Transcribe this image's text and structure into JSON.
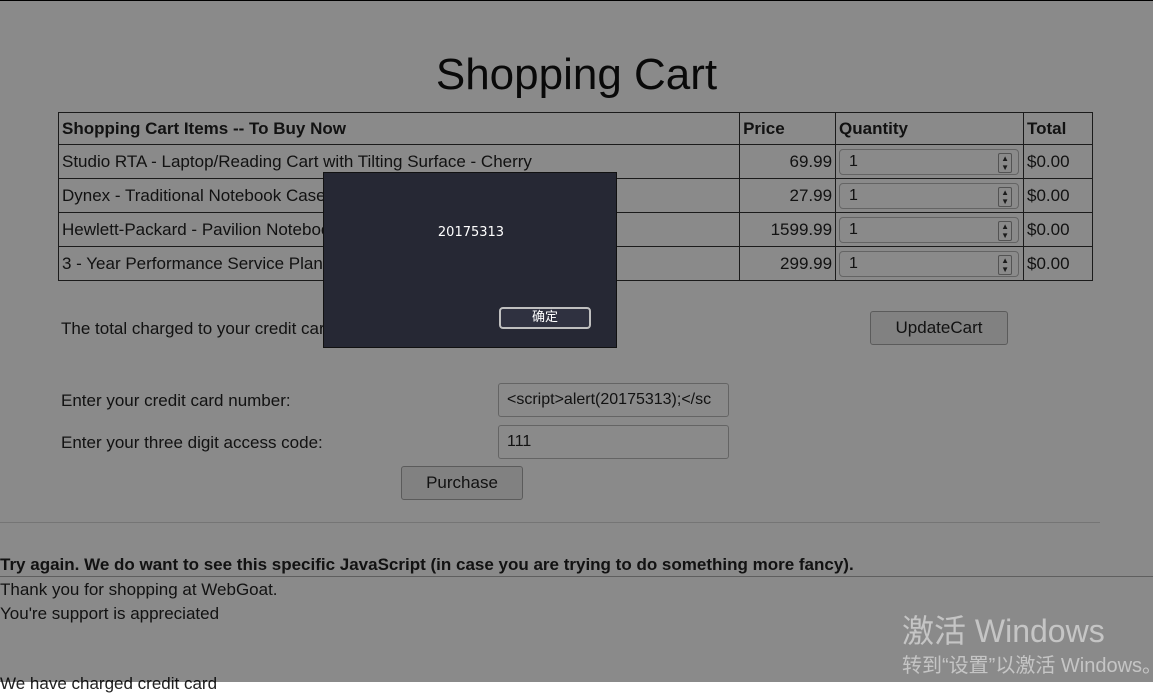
{
  "page": {
    "title": "Shopping Cart"
  },
  "cart": {
    "headers": [
      "Shopping Cart Items -- To Buy Now",
      "Price",
      "Quantity",
      "Total"
    ],
    "rows": [
      {
        "item": "Studio RTA - Laptop/Reading Cart with Tilting Surface - Cherry",
        "price": "69.99",
        "qty": "1",
        "total": "$0.00"
      },
      {
        "item": "Dynex - Traditional Notebook Case",
        "price": "27.99",
        "qty": "1",
        "total": "$0.00"
      },
      {
        "item": "Hewlett-Packard - Pavilion Notebook",
        "price": "1599.99",
        "qty": "1",
        "total": "$0.00"
      },
      {
        "item": "3 - Year Performance Service Plan",
        "price": "299.99",
        "qty": "1",
        "total": "$0.00"
      }
    ]
  },
  "summary": {
    "total_label": "The total charged to your credit card:",
    "update_button": "UpdateCart"
  },
  "form": {
    "card_label": "Enter your credit card number:",
    "card_value": "<script>alert(20175313);</sc",
    "code_label": "Enter your three digit access code:",
    "code_value": "111",
    "purchase_button": "Purchase"
  },
  "messages": {
    "feedback": "Try again. We do want to see this specific JavaScript (in case you are trying to do something more fancy).",
    "thanks": "Thank you for shopping at WebGoat.",
    "support": "You're support is appreciated",
    "cut_off": "We have charged credit card"
  },
  "alert": {
    "message": "20175313",
    "ok_button": "确定"
  },
  "watermark": {
    "line1": "激活 Windows",
    "line2": "转到“设置”以激活 Windows。"
  }
}
